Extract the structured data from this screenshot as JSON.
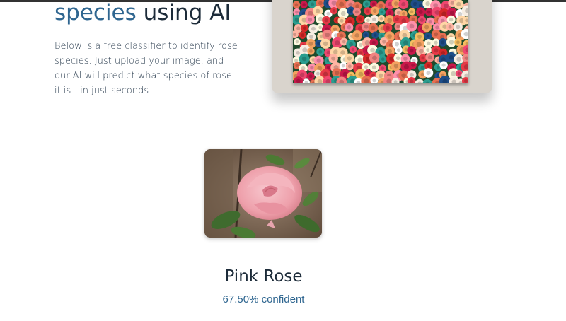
{
  "hero": {
    "title_accent": "species",
    "title_rest": " using AI",
    "description": "Below is a free classifier to identify rose species. Just upload your image, and our AI will predict what species of rose it is - in just seconds."
  },
  "result": {
    "label": "Pink Rose",
    "confidence": "67.50% confident",
    "confidence_value": 0.675
  },
  "colors": {
    "accent": "#2f6690",
    "heading": "#1c2b39",
    "frame": "#d9d4cd"
  }
}
